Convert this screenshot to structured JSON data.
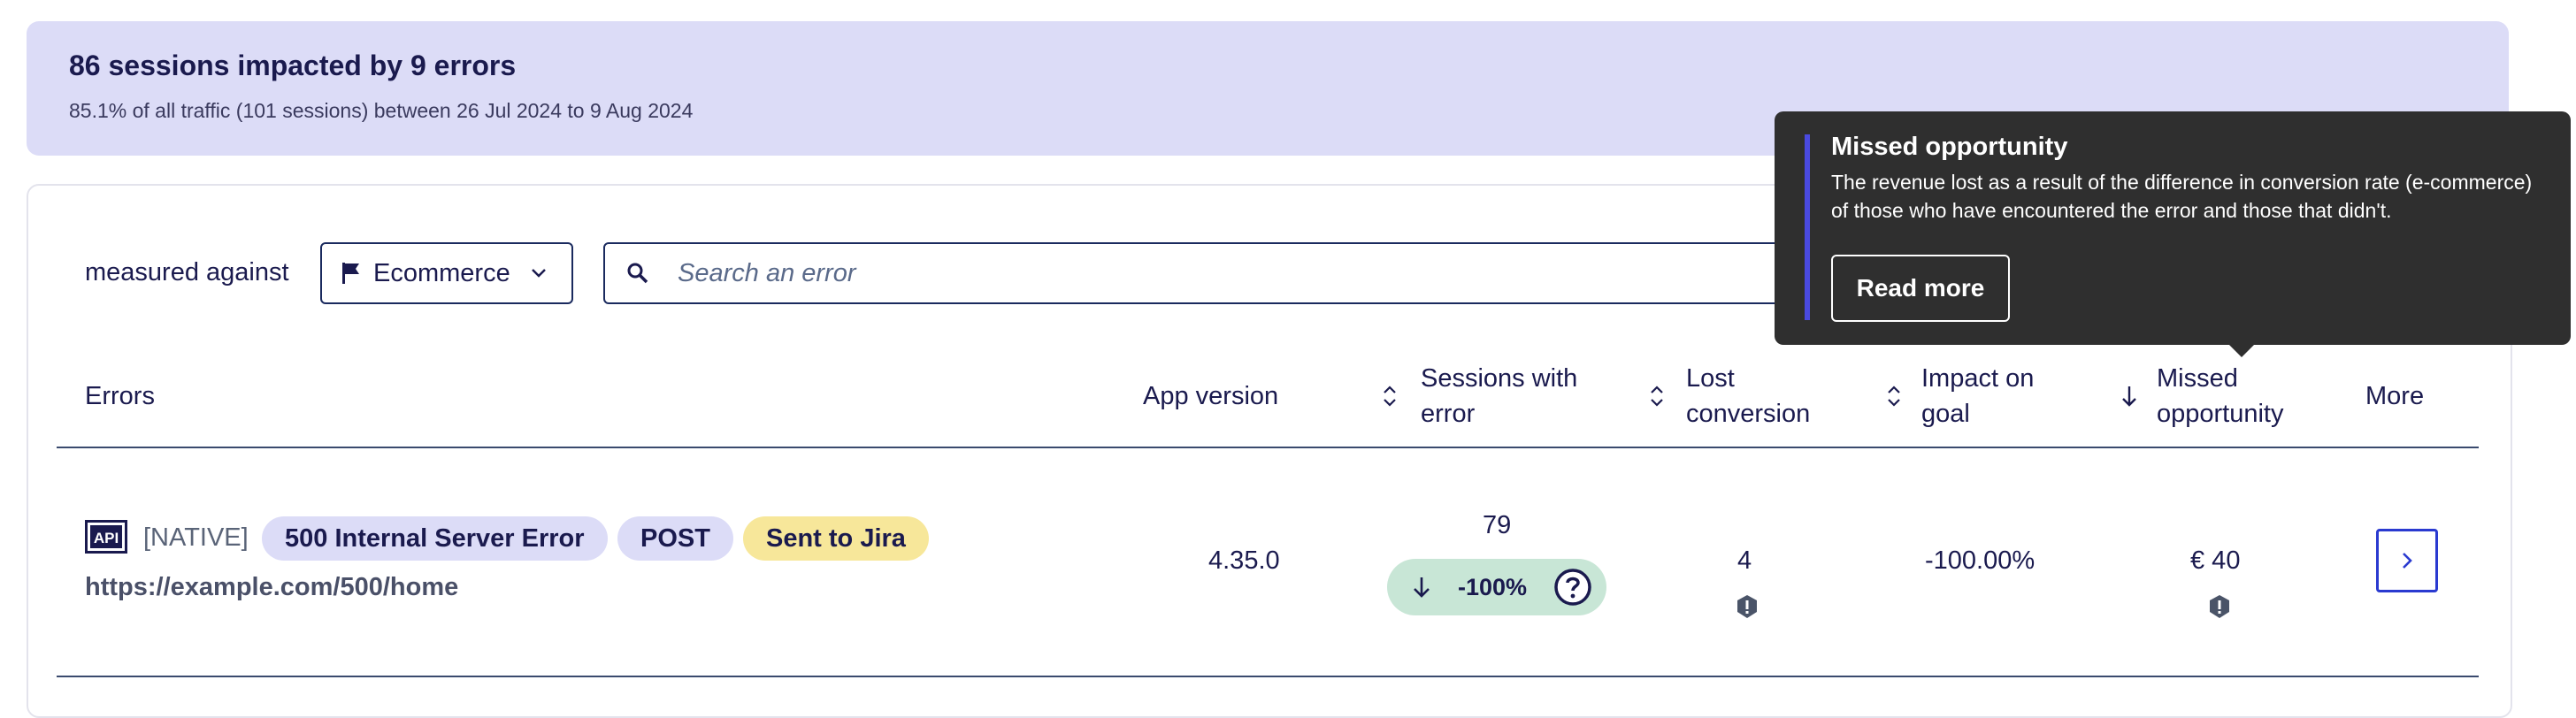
{
  "banner": {
    "title": "86 sessions impacted by 9 errors",
    "subtitle": "85.1% of all traffic (101 sessions) between 26 Jul 2024 to 9 Aug 2024"
  },
  "filters": {
    "measured_label": "measured against",
    "goal_select": "Ecommerce",
    "search_placeholder": "Search an error"
  },
  "table": {
    "headers": {
      "errors": "Errors",
      "app_version": "App version",
      "sessions_line1": "Sessions with",
      "sessions_line2": "error",
      "lost_line1": "Lost",
      "lost_line2": "conversion",
      "impact_line1": "Impact on",
      "impact_line2": "goal",
      "missed_line1": "Missed",
      "missed_line2": "opportunity",
      "more": "More"
    },
    "rows": [
      {
        "type": "[NATIVE]",
        "error_name": "500 Internal Server Error",
        "method": "POST",
        "status": "Sent to Jira",
        "url": "https://example.com/500/home",
        "app_version": "4.35.0",
        "sessions": "79",
        "sessions_trend": "-100%",
        "lost_conversion": "4",
        "impact": "-100.00%",
        "missed_opportunity": "€ 40"
      }
    ]
  },
  "tooltip": {
    "title": "Missed opportunity",
    "body": "The revenue lost as a result of the difference in conversion rate (e-commerce) of those who have encountered the error and those that didn't.",
    "button": "Read more"
  },
  "colors": {
    "accent": "#2a3ad0",
    "banner_bg": "#dcdcf7",
    "chip_yellow": "#f7e79a",
    "trend_green": "#c8e6d6",
    "tooltip_bg": "#2f2f2f"
  }
}
